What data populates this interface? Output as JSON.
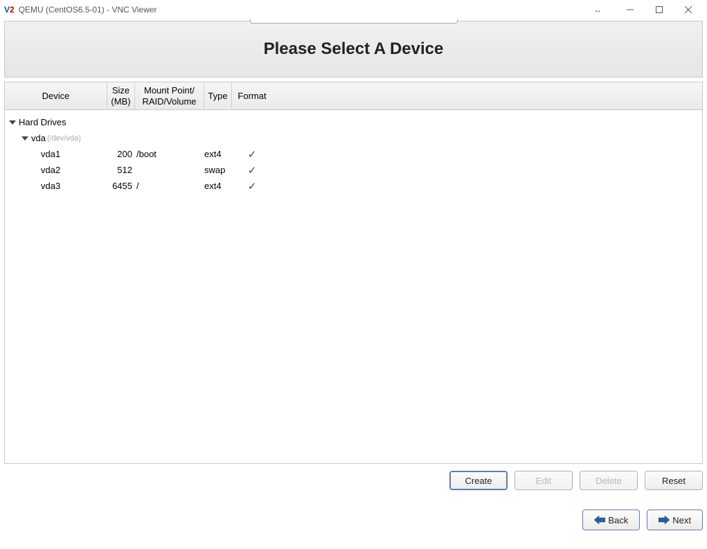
{
  "window": {
    "title": "QEMU (CentOS6.5-01) - VNC Viewer"
  },
  "header": {
    "title": "Please Select A Device"
  },
  "columns": {
    "device": "Device",
    "size_l1": "Size",
    "size_l2": "(MB)",
    "mount_l1": "Mount Point/",
    "mount_l2": "RAID/Volume",
    "type": "Type",
    "format": "Format"
  },
  "tree": {
    "l0_label": "Hard Drives",
    "l1_label": "vda",
    "l1_path": "(/dev/vda)",
    "rows": [
      {
        "device": "vda1",
        "size": "200",
        "mount": "/boot",
        "type": "ext4",
        "format": true
      },
      {
        "device": "vda2",
        "size": "512",
        "mount": "",
        "type": "swap",
        "format": true
      },
      {
        "device": "vda3",
        "size": "6455",
        "mount": "/",
        "type": "ext4",
        "format": true
      }
    ]
  },
  "buttons": {
    "create": "Create",
    "edit": "Edit",
    "delete": "Delete",
    "reset": "Reset",
    "back": "Back",
    "next": "Next"
  }
}
